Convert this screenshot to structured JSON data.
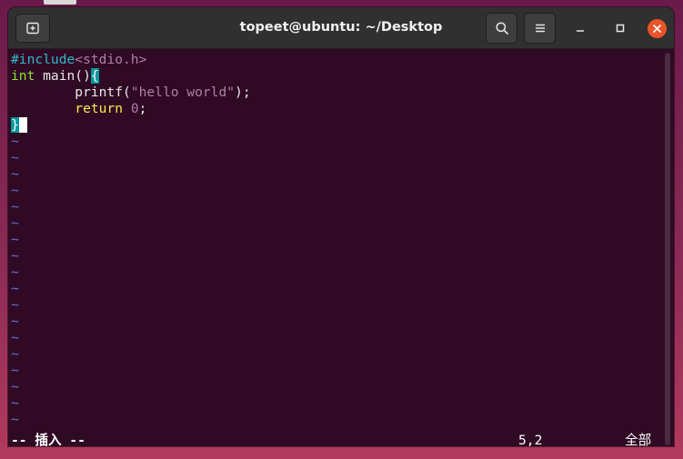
{
  "window": {
    "title": "topeet@ubuntu: ~/Desktop",
    "icons": {
      "new_tab": "new-tab-icon",
      "search": "search-icon",
      "menu": "hamburger-menu-icon",
      "minimize": "minimize-icon",
      "maximize": "maximize-icon",
      "close": "close-icon"
    }
  },
  "editor": {
    "lines": [
      {
        "segments": [
          {
            "text": "#include",
            "style": "pre"
          },
          {
            "text": "<stdio.h>",
            "style": "str"
          }
        ]
      },
      {
        "segments": [
          {
            "text": "int",
            "style": "type"
          },
          {
            "text": " main()",
            "style": "plain"
          },
          {
            "text": "{",
            "style": "match"
          }
        ]
      },
      {
        "segments": [
          {
            "text": "        printf(",
            "style": "plain"
          },
          {
            "text": "\"hello world\"",
            "style": "str"
          },
          {
            "text": ");",
            "style": "plain"
          }
        ]
      },
      {
        "segments": [
          {
            "text": "        ",
            "style": "plain"
          },
          {
            "text": "return",
            "style": "kw"
          },
          {
            "text": " ",
            "style": "plain"
          },
          {
            "text": "0",
            "style": "num"
          },
          {
            "text": ";",
            "style": "plain"
          }
        ]
      },
      {
        "segments": [
          {
            "text": "}",
            "style": "match"
          },
          {
            "text": " ",
            "style": "cursor"
          }
        ]
      }
    ],
    "tilde_char": "~",
    "tilde_count": 18
  },
  "statusline": {
    "mode": "-- 插入 --",
    "position": "5,2",
    "percentage": "全部"
  },
  "colors": {
    "terminal_bg": "#300a24",
    "titlebar_bg": "#303030",
    "close_button": "#e9542a",
    "preprocessor": "#34b8c8",
    "string": "#ad7fa8",
    "type": "#8ae234",
    "keyword": "#fce94f",
    "tilde": "#6e6ecf"
  }
}
